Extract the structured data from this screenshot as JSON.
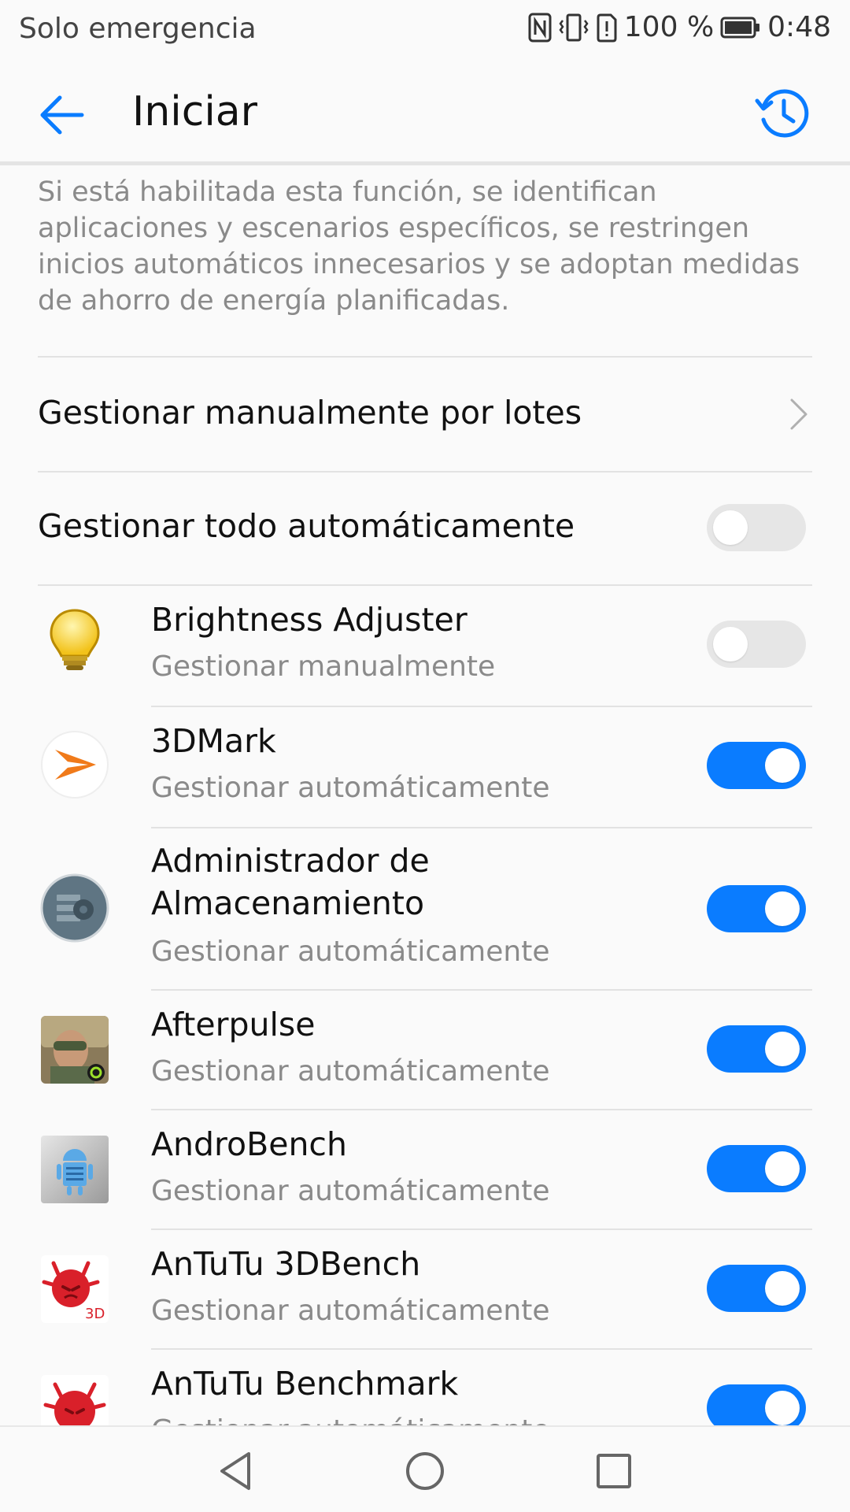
{
  "status_bar": {
    "carrier": "Solo emergencia",
    "battery": "100 %",
    "time": "0:48"
  },
  "app_bar": {
    "title": "Iniciar"
  },
  "description": "Si está habilitada esta función, se identifican aplicaciones y escenarios específicos, se restringen inicios automáticos innecesarios y se adoptan medidas de ahorro de energía planificadas.",
  "batch_row": {
    "label": "Gestionar manualmente por lotes"
  },
  "auto_all_row": {
    "label": "Gestionar todo automáticamente",
    "enabled": false
  },
  "apps": [
    {
      "name": "Brightness Adjuster",
      "status": "Gestionar manualmente",
      "enabled": false,
      "icon": "lightbulb-icon"
    },
    {
      "name": "3DMark",
      "status": "Gestionar automáticamente",
      "enabled": true,
      "icon": "3dmark-icon"
    },
    {
      "name": "Administrador de Almacenamiento",
      "status": "Gestionar automáticamente",
      "enabled": true,
      "icon": "storage-manager-icon"
    },
    {
      "name": "Afterpulse",
      "status": "Gestionar automáticamente",
      "enabled": true,
      "icon": "afterpulse-icon"
    },
    {
      "name": "AndroBench",
      "status": "Gestionar automáticamente",
      "enabled": true,
      "icon": "androbench-icon"
    },
    {
      "name": "AnTuTu 3DBench",
      "status": "Gestionar automáticamente",
      "enabled": true,
      "icon": "antutu-3dbench-icon"
    },
    {
      "name": "AnTuTu Benchmark",
      "status": "Gestionar automáticamente",
      "enabled": true,
      "icon": "antutu-benchmark-icon"
    }
  ],
  "colors": {
    "accent": "#0a7cff",
    "toggle_off": "#e6e6e6",
    "secondary_text": "#8a8a8a"
  }
}
